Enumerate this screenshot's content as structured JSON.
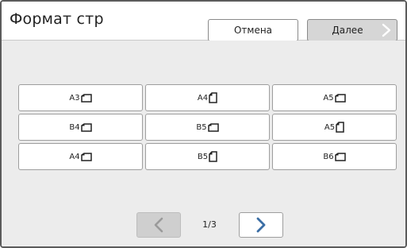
{
  "header": {
    "title": "Формат стр"
  },
  "buttons": {
    "cancel": "Отмена",
    "next": "Далее"
  },
  "sizes": [
    {
      "label": "A3",
      "orientation": "landscape"
    },
    {
      "label": "A4",
      "orientation": "portrait"
    },
    {
      "label": "A5",
      "orientation": "landscape"
    },
    {
      "label": "B4",
      "orientation": "landscape"
    },
    {
      "label": "B5",
      "orientation": "landscape"
    },
    {
      "label": "A5",
      "orientation": "portrait"
    },
    {
      "label": "A4",
      "orientation": "landscape"
    },
    {
      "label": "B5",
      "orientation": "portrait"
    },
    {
      "label": "B6",
      "orientation": "landscape"
    }
  ],
  "pager": {
    "indicator": "1/3"
  },
  "colors": {
    "accent": "#3b6ea5",
    "disabled": "#9a9a9a"
  }
}
